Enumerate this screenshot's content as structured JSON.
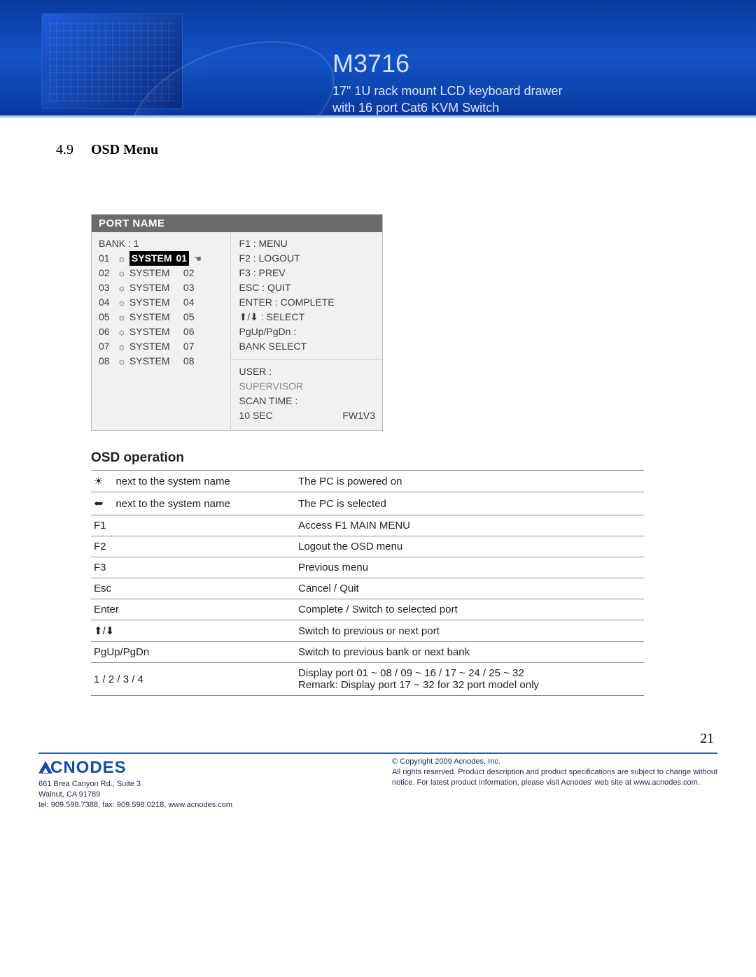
{
  "header": {
    "model": "M3716",
    "subtitle1": "17\" 1U rack mount LCD keyboard drawer",
    "subtitle2": "with 16 port Cat6 KVM Switch"
  },
  "section": {
    "number": "4.9",
    "title": "OSD Menu"
  },
  "osd": {
    "titlebar": "PORT  NAME",
    "bank_label": "BANK : 1",
    "ports": [
      {
        "num": "01",
        "name": "SYSTEM",
        "id": "01",
        "selected": true
      },
      {
        "num": "02",
        "name": "SYSTEM",
        "id": "02",
        "selected": false
      },
      {
        "num": "03",
        "name": "SYSTEM",
        "id": "03",
        "selected": false
      },
      {
        "num": "04",
        "name": "SYSTEM",
        "id": "04",
        "selected": false
      },
      {
        "num": "05",
        "name": "SYSTEM",
        "id": "05",
        "selected": false
      },
      {
        "num": "06",
        "name": "SYSTEM",
        "id": "06",
        "selected": false
      },
      {
        "num": "07",
        "name": "SYSTEM",
        "id": "07",
        "selected": false
      },
      {
        "num": "08",
        "name": "SYSTEM",
        "id": "08",
        "selected": false
      }
    ],
    "help": [
      "F1 : MENU",
      "F2 : LOGOUT",
      "F3 : PREV",
      "ESC : QUIT",
      "ENTER : COMPLETE",
      "⬆/⬇ : SELECT",
      "PgUp/PgDn :",
      "BANK SELECT"
    ],
    "user_label": "USER :",
    "user_value": "SUPERVISOR",
    "scan_label": "SCAN TIME :",
    "scan_value": "10 SEC",
    "fw": "FW1V3"
  },
  "operation": {
    "title": "OSD operation",
    "rows": [
      {
        "key_icon": "sun",
        "key_text": "next to the system name",
        "desc": "The PC is powered on"
      },
      {
        "key_icon": "hand",
        "key_text": "next to the system name",
        "desc": "The PC is selected"
      },
      {
        "key_icon": "",
        "key_text": "F1",
        "desc": "Access F1 MAIN MENU"
      },
      {
        "key_icon": "",
        "key_text": "F2",
        "desc": "Logout the OSD menu"
      },
      {
        "key_icon": "",
        "key_text": "F3",
        "desc": "Previous menu"
      },
      {
        "key_icon": "",
        "key_text": "Esc",
        "desc": "Cancel / Quit"
      },
      {
        "key_icon": "",
        "key_text": "Enter",
        "desc": "Complete / Switch to selected port"
      },
      {
        "key_icon": "arrows",
        "key_text": "",
        "desc": "Switch to previous or next port"
      },
      {
        "key_icon": "",
        "key_text": "PgUp/PgDn",
        "desc": "Switch to previous bank or next bank"
      },
      {
        "key_icon": "",
        "key_text": "1 / 2 / 3 / 4",
        "desc": "Display port  01 ~ 08 / 09 ~ 16 / 17 ~ 24 / 25 ~ 32\nRemark:  Display port 17 ~ 32 for 32 port model only"
      }
    ]
  },
  "page_number": "21",
  "footer": {
    "logo_text": "CNODES",
    "address1": "661 Brea Canyon Rd., Suite 3",
    "address2": "Walnut, CA 91789",
    "contact": "tel: 909.598.7388, fax: 909.598.0218, www.acnodes.com",
    "copyright": "© Copyright 2009 Acnodes, Inc.",
    "legal": "All rights reserved. Product description and product specifications are subject to change without notice. For latest product information, please visit Acnodes' web site at www.acnodes.com."
  }
}
